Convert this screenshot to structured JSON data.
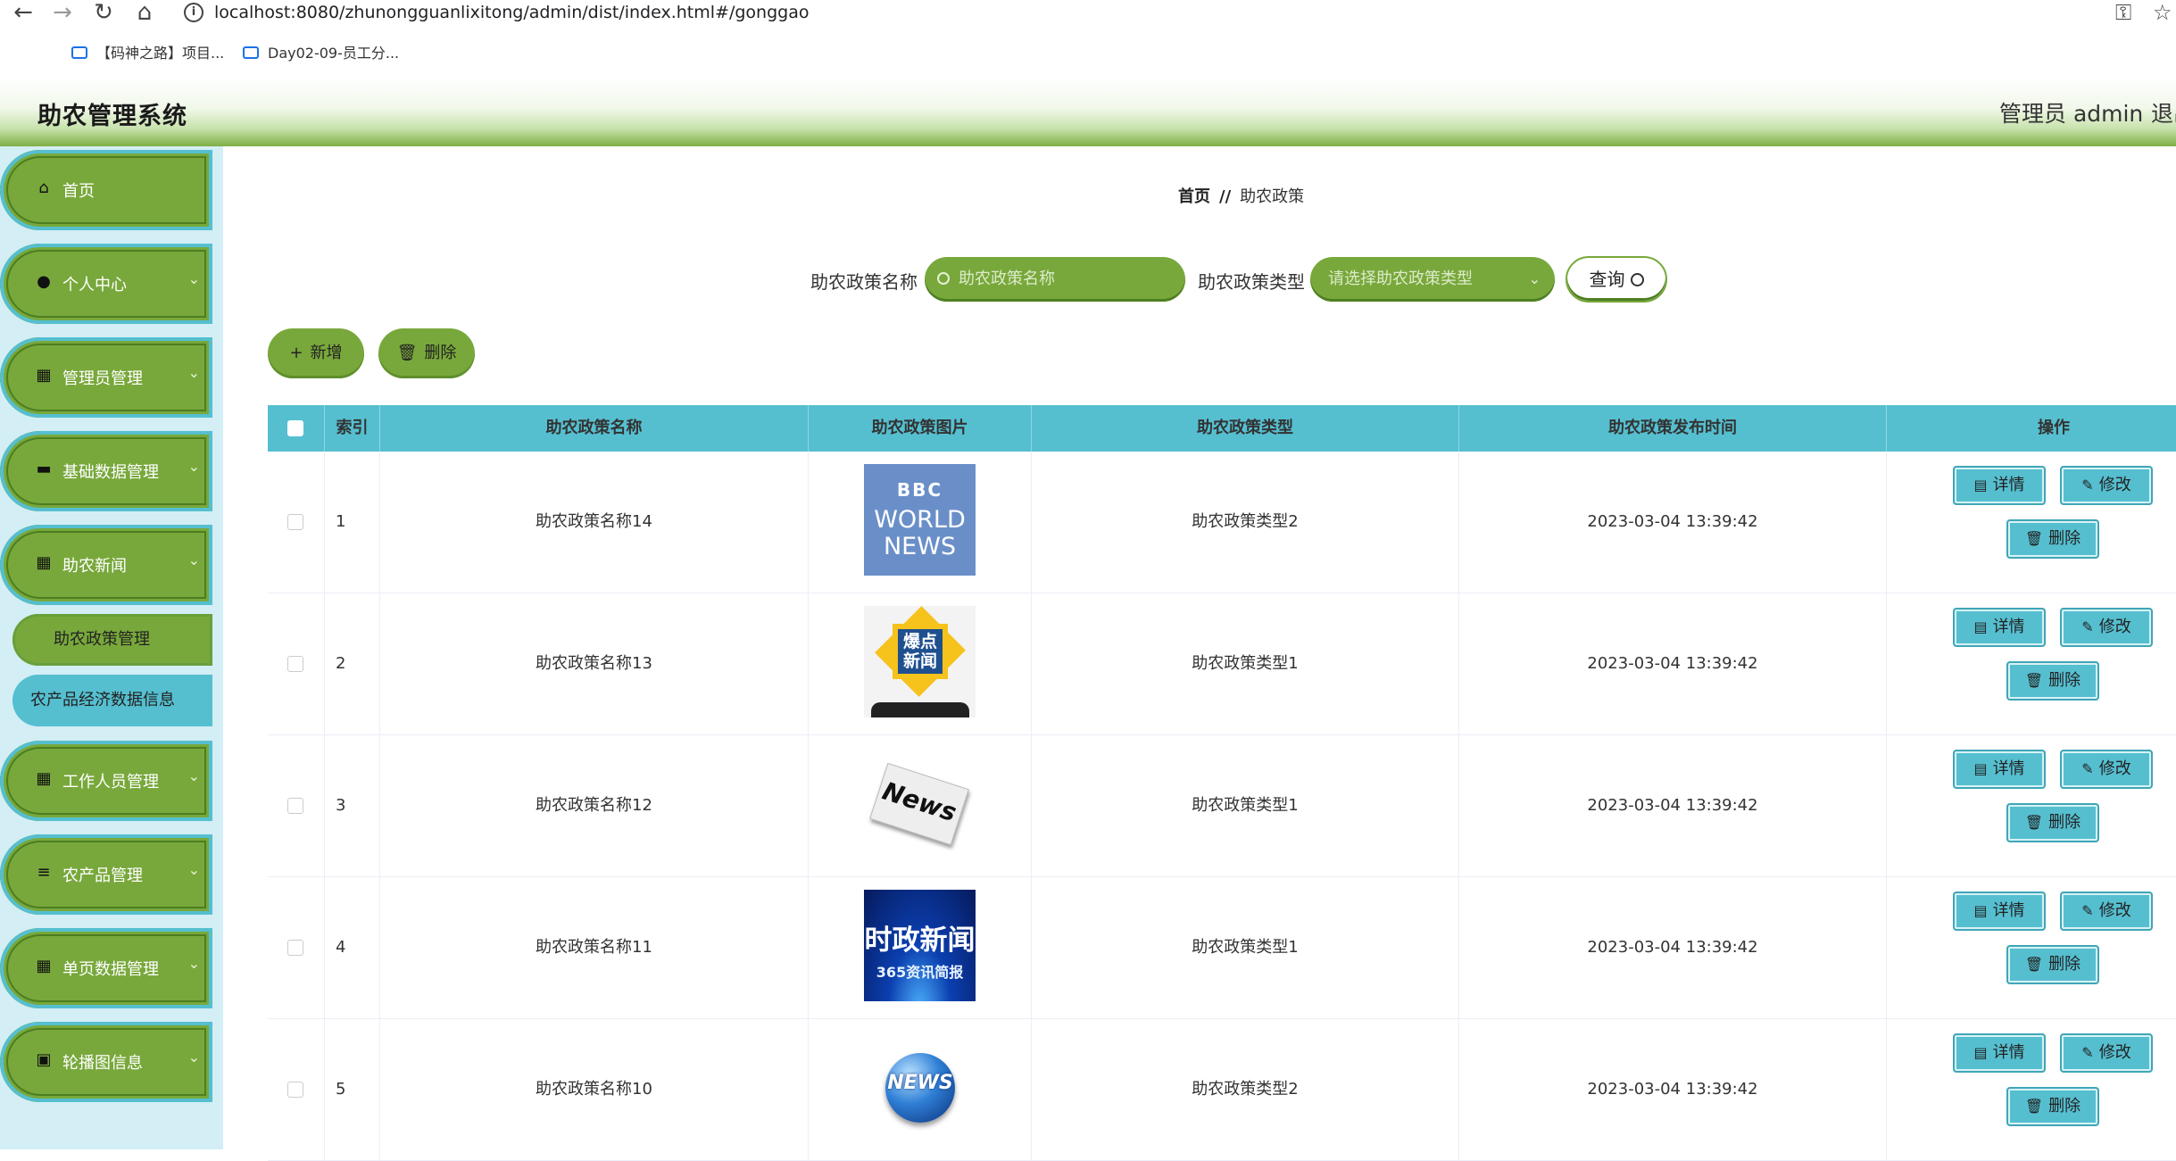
{
  "browser": {
    "url": "localhost:8080/zhunongguanlixitong/admin/dist/index.html#/gonggao",
    "bookmarks": [
      {
        "label": "【码神之路】项目..."
      },
      {
        "label": "Day02-09-员工分..."
      }
    ]
  },
  "header": {
    "title": "助农管理系统",
    "user": "管理员 admin",
    "logout": "退出"
  },
  "sidebar": {
    "items": [
      {
        "label": "首页",
        "icon": "home-icon",
        "expandable": false
      },
      {
        "label": "个人中心",
        "icon": "user-icon",
        "expandable": true
      },
      {
        "label": "管理员管理",
        "icon": "grid-icon",
        "expandable": true
      },
      {
        "label": "基础数据管理",
        "icon": "database-icon",
        "expandable": true
      },
      {
        "label": "助农新闻",
        "icon": "grid-icon",
        "expandable": true
      },
      {
        "label": "工作人员管理",
        "icon": "grid-icon",
        "expandable": true
      },
      {
        "label": "农产品管理",
        "icon": "sliders-icon",
        "expandable": true
      },
      {
        "label": "单页数据管理",
        "icon": "grid-icon",
        "expandable": true
      },
      {
        "label": "轮播图信息",
        "icon": "image-icon",
        "expandable": true
      }
    ],
    "subitems": [
      {
        "label": "助农政策管理",
        "state": "active"
      },
      {
        "label": "农产品经济数据信息",
        "state": "hover"
      }
    ]
  },
  "breadcrumb": {
    "home": "首页",
    "separator": "//",
    "current": "助农政策"
  },
  "search": {
    "name_label": "助农政策名称",
    "name_placeholder": "助农政策名称",
    "type_label": "助农政策类型",
    "type_placeholder": "请选择助农政策类型",
    "query_label": "查询"
  },
  "actions": {
    "add_label": "新增",
    "delete_label": "删除"
  },
  "table": {
    "columns": [
      "索引",
      "助农政策名称",
      "助农政策图片",
      "助农政策类型",
      "助农政策发布时间",
      "操作"
    ],
    "rows": [
      {
        "index": "1",
        "name": "助农政策名称14",
        "image": "bbc-world-news-thumbnail",
        "image_text": [
          "BBC",
          "WORLD",
          "NEWS"
        ],
        "type": "助农政策类型2",
        "time": "2023-03-04 13:39:42"
      },
      {
        "index": "2",
        "name": "助农政策名称13",
        "image": "baodian-xinwen-thumbnail",
        "image_text": [
          "爆点",
          "新闻"
        ],
        "type": "助农政策类型1",
        "time": "2023-03-04 13:39:42"
      },
      {
        "index": "3",
        "name": "助农政策名称12",
        "image": "newspaper-thumbnail",
        "image_text": [
          "News"
        ],
        "type": "助农政策类型1",
        "time": "2023-03-04 13:39:42"
      },
      {
        "index": "4",
        "name": "助农政策名称11",
        "image": "shizheng-xinwen-thumbnail",
        "image_text": [
          "时政新闻",
          "365资讯简报"
        ],
        "type": "助农政策类型1",
        "time": "2023-03-04 13:39:42"
      },
      {
        "index": "5",
        "name": "助农政策名称10",
        "image": "globe-news-thumbnail",
        "image_text": [
          "NEWS"
        ],
        "type": "助农政策类型2",
        "time": "2023-03-04 13:39:42"
      }
    ],
    "row_actions": {
      "detail": "详情",
      "edit": "修改",
      "delete": "删除"
    }
  },
  "colors": {
    "primary_green": "#78a83b",
    "accent_cyan": "#55bfd0",
    "sidebar_bg": "#d3eef5"
  }
}
